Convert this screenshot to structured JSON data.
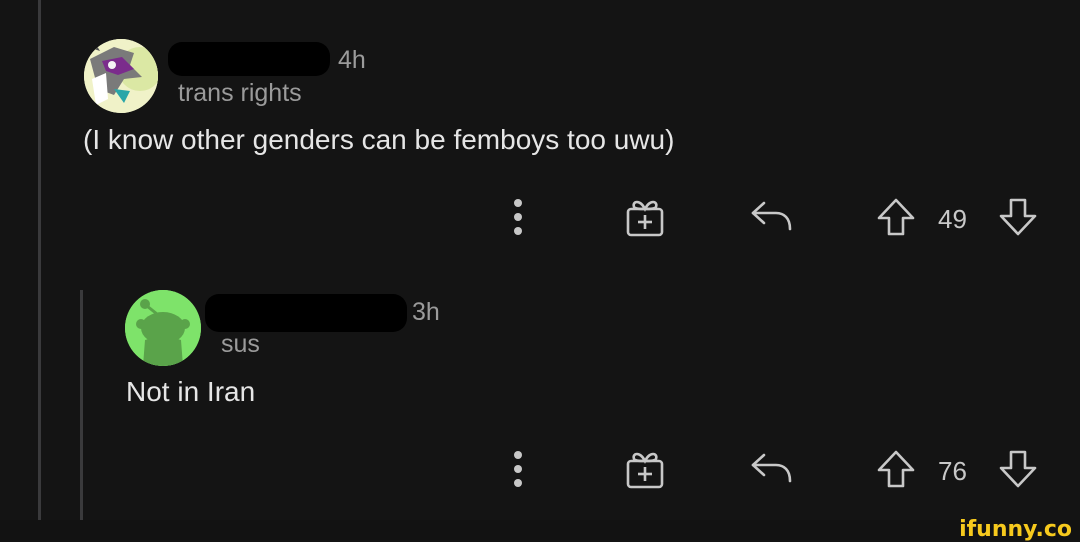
{
  "comments": [
    {
      "age": "4h",
      "flair": "trans rights",
      "text": "(I know other genders can be femboys too uwu)",
      "score": "49"
    },
    {
      "age": "3h",
      "flair": "sus",
      "text": "Not in Iran",
      "score": "76"
    }
  ],
  "icons": {
    "more": "more-vertical-icon",
    "award": "gift-award-icon",
    "reply": "reply-arrow-icon",
    "upvote": "upvote-arrow-icon",
    "downvote": "downvote-arrow-icon"
  },
  "watermark": "ifunny.co",
  "colors": {
    "background": "#141414",
    "text": "#e6e6e6",
    "muted": "#9b9b9b",
    "avatar_green": "#7ee36a",
    "watermark": "#f6c91d"
  }
}
